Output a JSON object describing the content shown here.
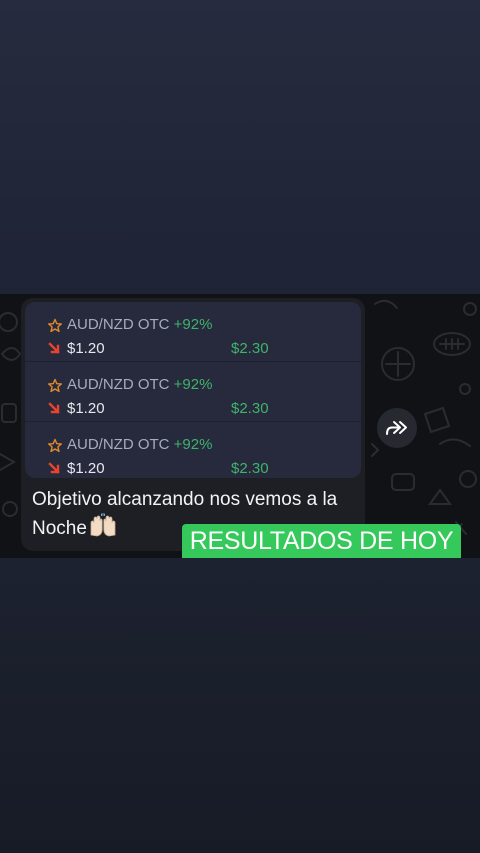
{
  "trades": [
    {
      "pair": "AUD/NZD OTC",
      "payout": "+92%",
      "bet": "$1.20",
      "win": "$2.30"
    },
    {
      "pair": "AUD/NZD OTC",
      "payout": "+92%",
      "bet": "$1.20",
      "win": "$2.30"
    },
    {
      "pair": "AUD/NZD OTC",
      "payout": "+92%",
      "bet": "$1.20",
      "win": "$2.30"
    }
  ],
  "message": {
    "line1": "Objetivo alcanzando nos vemos a la",
    "line2": "Noche"
  },
  "overlay": {
    "badge": "RESULTADOS DE HOY"
  },
  "icons": {
    "star": "star-outline-icon",
    "arrow": "arrow-down-right-icon",
    "emoji": "raised-hands-icon",
    "forward": "forward-icon"
  },
  "colors": {
    "payout": "#3fb36b",
    "badge": "#35c85a",
    "star": "#e08a2e",
    "arrow": "#e8432c"
  }
}
